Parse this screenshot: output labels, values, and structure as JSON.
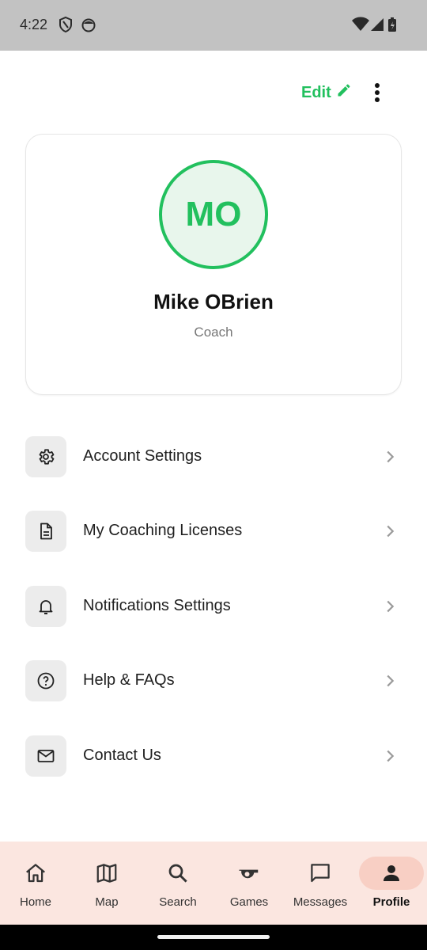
{
  "status_bar": {
    "time": "4:22",
    "icons": [
      "shield-icon",
      "face-icon",
      "wifi-icon",
      "signal-icon",
      "battery-icon"
    ]
  },
  "header": {
    "edit_label": "Edit",
    "edit_icon": "pencil-icon",
    "more_icon": "more-vert-icon"
  },
  "profile": {
    "initials": "MO",
    "name": "Mike OBrien",
    "role": "Coach"
  },
  "menu": {
    "items": [
      {
        "label": "Account Settings",
        "icon": "gear-icon"
      },
      {
        "label": "My Coaching Licenses",
        "icon": "document-icon"
      },
      {
        "label": "Notifications Settings",
        "icon": "bell-icon"
      },
      {
        "label": "Help & FAQs",
        "icon": "help-circle-icon"
      },
      {
        "label": "Contact Us",
        "icon": "mail-icon"
      }
    ]
  },
  "bottom_nav": {
    "active": "Profile",
    "items": [
      {
        "label": "Home",
        "icon": "home-icon"
      },
      {
        "label": "Map",
        "icon": "map-icon"
      },
      {
        "label": "Search",
        "icon": "search-icon"
      },
      {
        "label": "Games",
        "icon": "whistle-icon"
      },
      {
        "label": "Messages",
        "icon": "message-icon"
      },
      {
        "label": "Profile",
        "icon": "person-icon"
      }
    ]
  },
  "colors": {
    "accent_green": "#22c05e",
    "nav_background": "#fbe6e0",
    "nav_active_pill": "#f8cfc4",
    "status_bar": "#c2c2c2"
  }
}
